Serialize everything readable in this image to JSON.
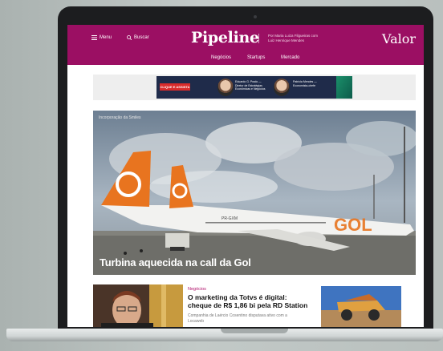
{
  "header": {
    "menu_label": "Menu",
    "search_label": "Buscar",
    "brand": "Pipeline",
    "byline": "Por Maria Luiza Filgueiras com Luiz Henrique Mendes",
    "publisher": "Valor"
  },
  "nav": {
    "items": [
      "Negócios",
      "Startups",
      "Mercado"
    ]
  },
  "ad": {
    "cta": "CLIQUE E ASSISTA",
    "speaker1": "Eduardo G. Prado — Diretor de Estratégias Econômicas e Negócios",
    "speaker2": "Patrícia Mendes — Economista-chefe"
  },
  "hero": {
    "kicker": "Incorporação da Smiles",
    "title": "Turbina aquecida na call da Gol",
    "aircraft_branding": "GOL",
    "tail_code": "PR-GXM"
  },
  "story": {
    "kicker": "Negócios",
    "title": "O marketing da Totvs é digital: cheque de R$ 1,86 bi pela RD Station",
    "summary": "Companhia de Laércio Cosentino disputava ativo com a Locaweb"
  },
  "colors": {
    "brand_magenta": "#9b0f63",
    "kicker_magenta": "#b0106a"
  }
}
